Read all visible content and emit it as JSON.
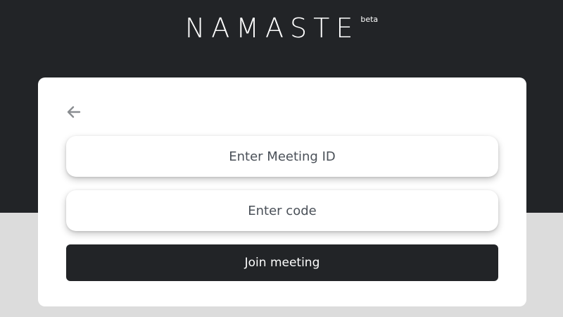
{
  "brand": {
    "name": "NAMASTE",
    "badge": "beta"
  },
  "form": {
    "back_icon": "arrow-left-icon",
    "meeting_id_placeholder": "Enter Meeting ID",
    "code_placeholder": "Enter code",
    "join_label": "Join meeting"
  },
  "colors": {
    "dark": "#222427",
    "light_bg": "#dcdcdc",
    "card": "#ffffff"
  }
}
